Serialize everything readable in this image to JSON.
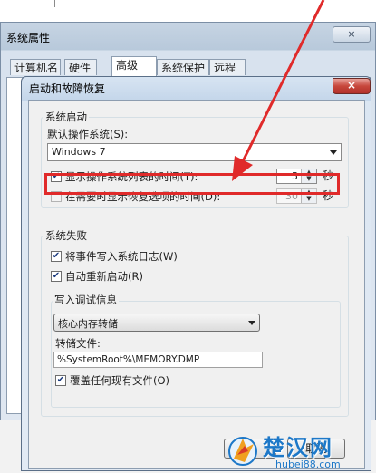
{
  "outer_window": {
    "title": "系统属性",
    "close": "×",
    "tabs": [
      "计算机名",
      "硬件",
      "高级",
      "系统保护",
      "远程"
    ]
  },
  "dialog": {
    "title": "启动和故障恢复",
    "close": "×",
    "startup": {
      "group_label": "系统启动",
      "default_os_label": "默认操作系统(S):",
      "default_os_value": "Windows 7",
      "show_list": {
        "label": "显示操作系统列表的时间(T):",
        "checked": true,
        "value": "5",
        "unit": "秒"
      },
      "show_recovery": {
        "label": "在需要时显示恢复选项的时间(D):",
        "checked": false,
        "value": "30",
        "unit": "秒"
      }
    },
    "failure": {
      "group_label": "系统失败",
      "write_event": {
        "label": "将事件写入系统日志(W)",
        "checked": true
      },
      "auto_restart": {
        "label": "自动重新启动(R)",
        "checked": true
      },
      "debug": {
        "group_label": "写入调试信息",
        "dump_type": "核心内存转储",
        "dump_file_label": "转储文件:",
        "dump_file_value": "%SystemRoot%\\MEMORY.DMP",
        "overwrite": {
          "label": "覆盖任何现有文件(O)",
          "checked": true
        }
      }
    },
    "buttons": {
      "ok": "确",
      "cancel": "取消"
    }
  },
  "watermark": {
    "text": "楚汉网",
    "url": "hubei88.com"
  },
  "colors": {
    "highlight": "#e02a2a",
    "watermark": "#1d78c8"
  }
}
